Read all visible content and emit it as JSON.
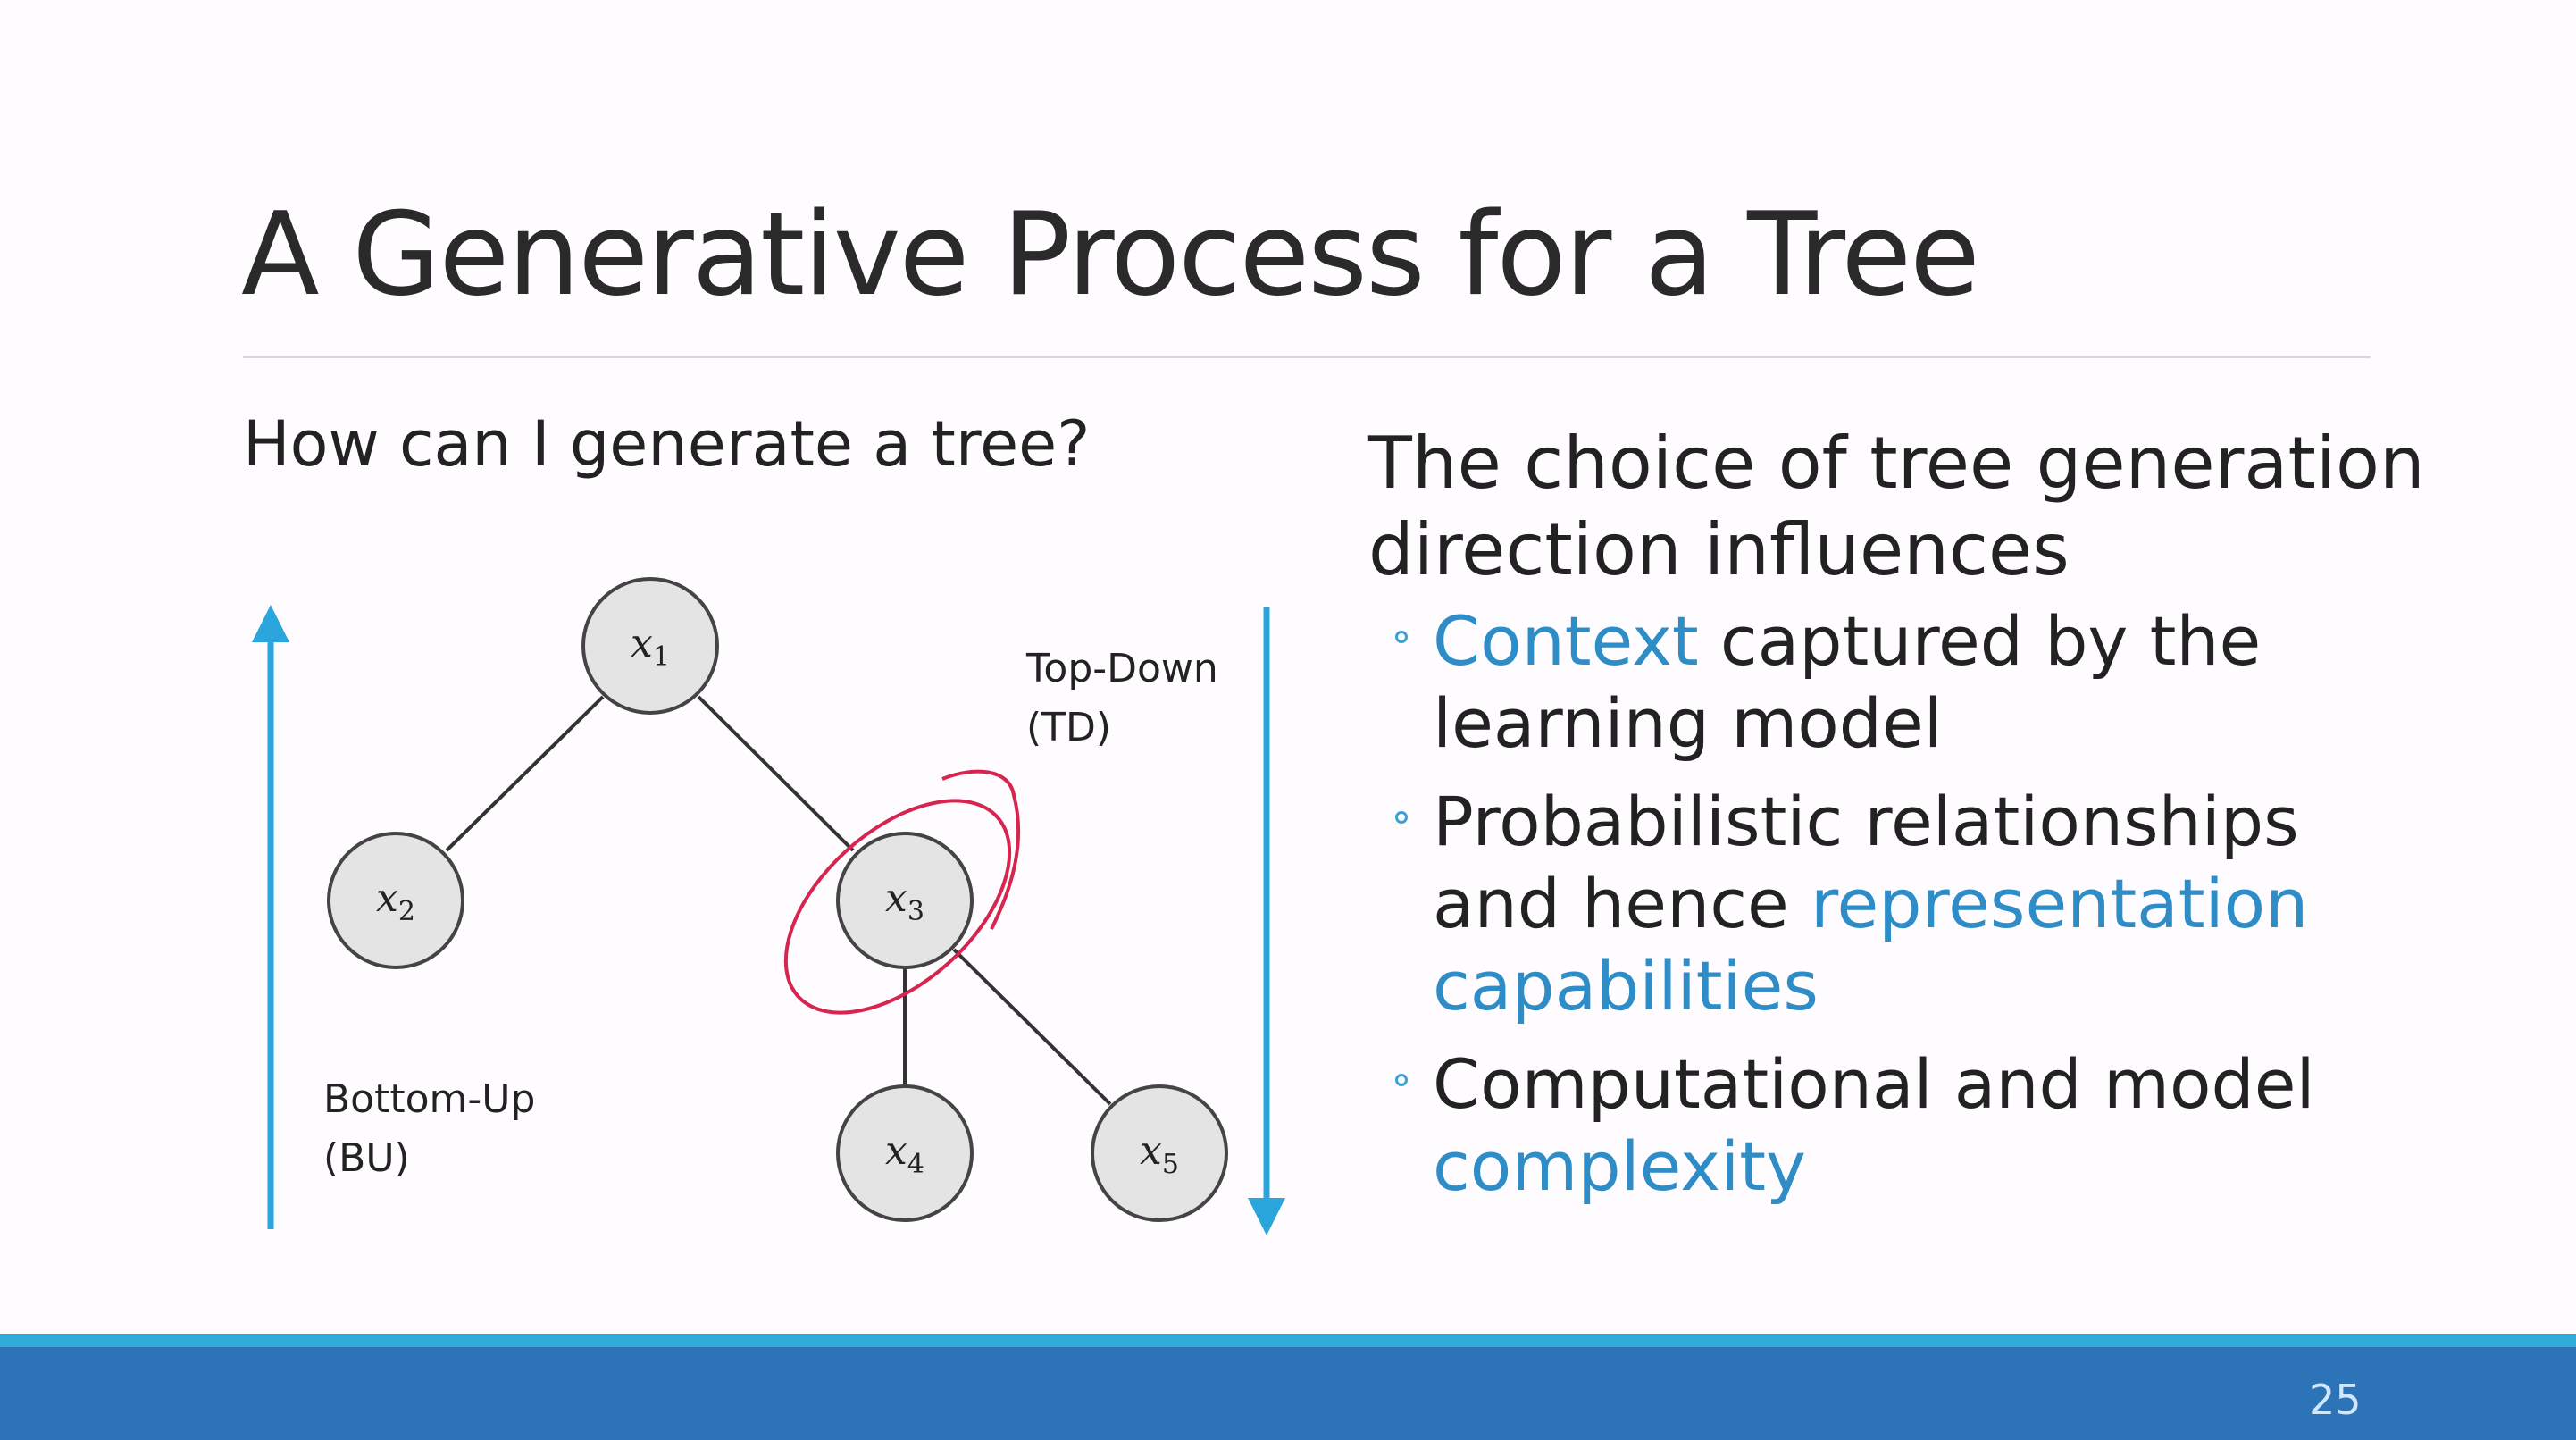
{
  "slide": {
    "title": "A Generative Process for a Tree",
    "question": "How can I generate a tree?",
    "page_number": "25"
  },
  "diagram": {
    "nodes": [
      {
        "var": "x",
        "sub": "1"
      },
      {
        "var": "x",
        "sub": "2"
      },
      {
        "var": "x",
        "sub": "3"
      },
      {
        "var": "x",
        "sub": "4"
      },
      {
        "var": "x",
        "sub": "5"
      }
    ],
    "edges": [
      [
        "x1",
        "x2"
      ],
      [
        "x1",
        "x3"
      ],
      [
        "x3",
        "x4"
      ],
      [
        "x3",
        "x5"
      ]
    ],
    "top_down_label": [
      "Top-Down",
      "(TD)"
    ],
    "bottom_up_label": [
      "Bottom-Up",
      "(BU)"
    ],
    "highlighted_node": "x3"
  },
  "right": {
    "heading": "The choice of tree generation direction influences",
    "bullets": [
      {
        "parts": [
          {
            "text": "Context",
            "hl": true
          },
          {
            "text": " captured by the learning model",
            "hl": false
          }
        ]
      },
      {
        "parts": [
          {
            "text": "Probabilistic relationships and hence ",
            "hl": false
          },
          {
            "text": "representation capabilities",
            "hl": true
          }
        ]
      },
      {
        "parts": [
          {
            "text": "Computational and model ",
            "hl": false
          },
          {
            "text": "complexity",
            "hl": true
          }
        ]
      }
    ]
  },
  "colors": {
    "accent": "#2e8cc6",
    "arrow": "#2aa6dc",
    "annotation": "#d6254e",
    "footer": "#2c73b8",
    "footer_strip": "#2fadd8"
  }
}
